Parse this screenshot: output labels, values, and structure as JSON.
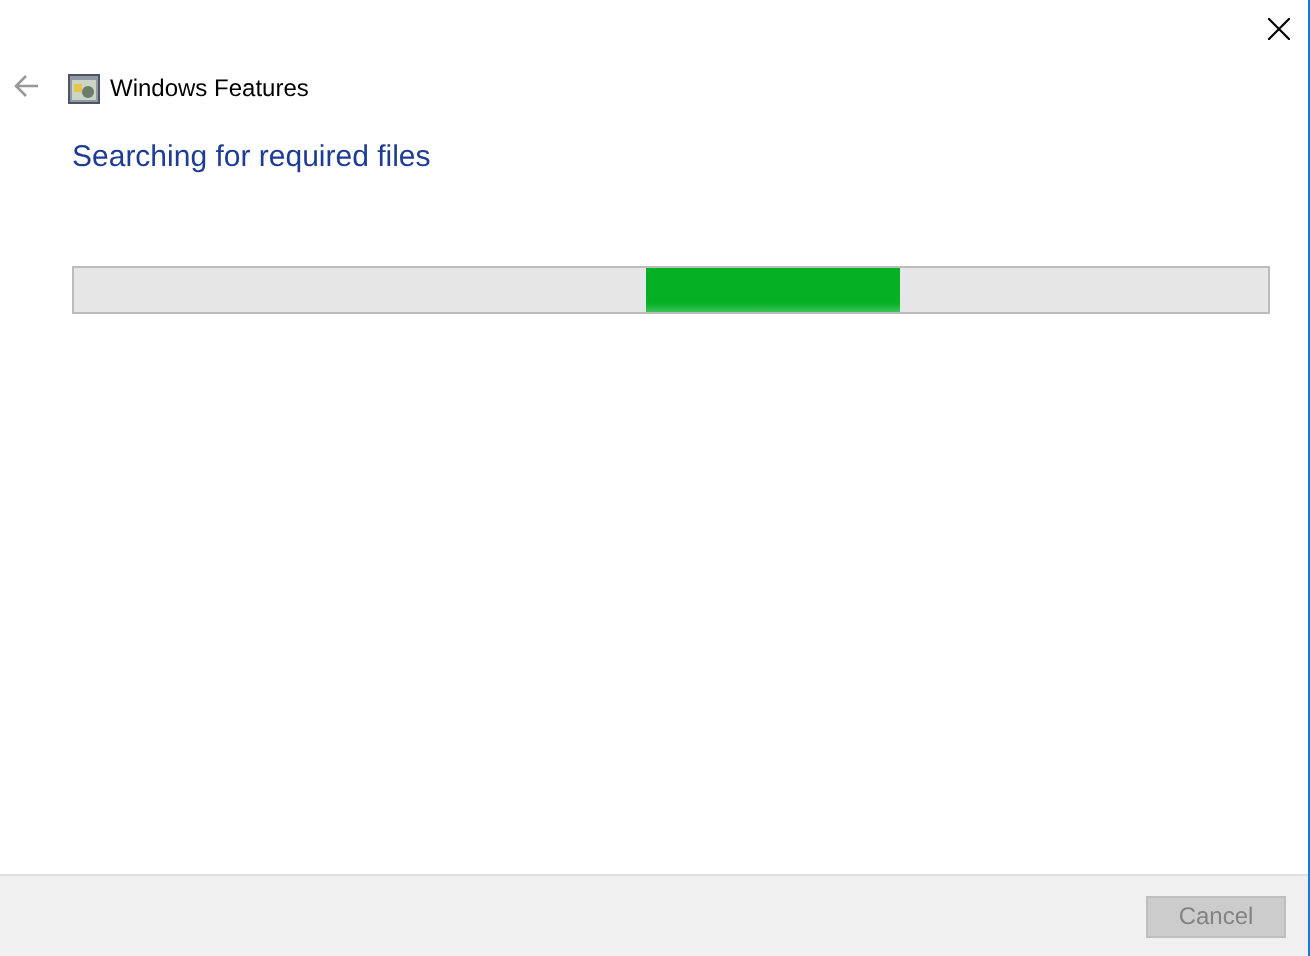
{
  "window": {
    "title": "Windows Features"
  },
  "heading": "Searching for required files",
  "progress": {
    "indeterminate": true
  },
  "buttons": [
    {
      "label": "Cancel",
      "disabled": true
    }
  ]
}
